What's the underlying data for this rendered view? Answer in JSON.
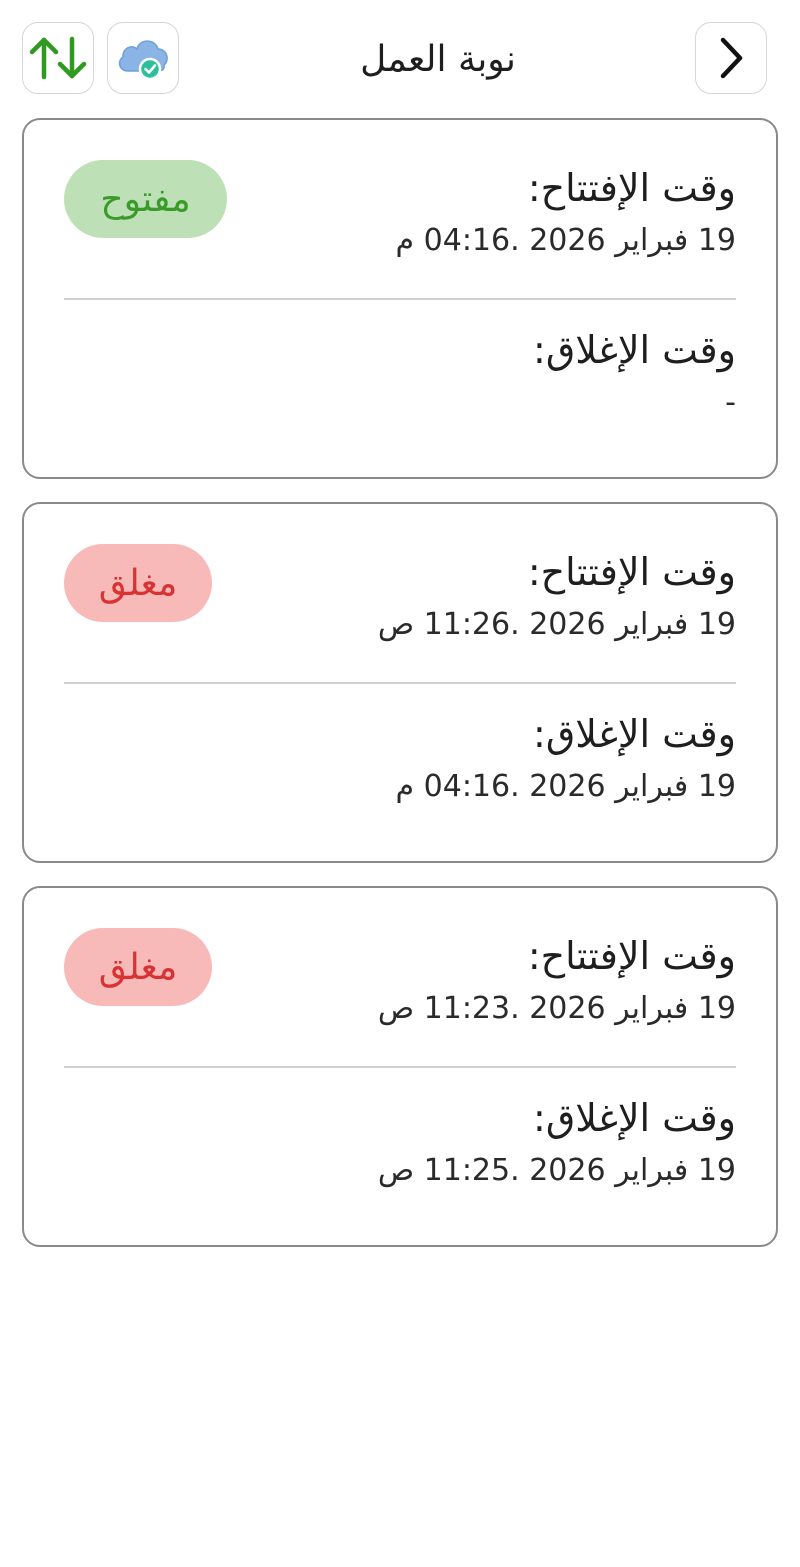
{
  "header": {
    "title": "نوبة العمل",
    "sort_icon": "sort-up-down-icon",
    "sync_icon": "cloud-synced-icon",
    "back_icon": "chevron-right-icon",
    "colors": {
      "sort_arrows": "#2e9a1f",
      "cloud": "#8ab4e6",
      "check_badge": "#2bbf9e"
    }
  },
  "shifts": [
    {
      "opening_label": "وقت الإفتتاح:",
      "opening_value": "19 فبراير 2026 .04:16 م",
      "closing_label": "وقت الإغلاق:",
      "closing_value": "-",
      "status": "مفتوح",
      "status_type": "open"
    },
    {
      "opening_label": "وقت الإفتتاح:",
      "opening_value": "19 فبراير 2026 .11:26 ص",
      "closing_label": "وقت الإغلاق:",
      "closing_value": "19 فبراير 2026 .04:16 م",
      "status": "مغلق",
      "status_type": "closed"
    },
    {
      "opening_label": "وقت الإفتتاح:",
      "opening_value": "19 فبراير 2026 .11:23 ص",
      "closing_label": "وقت الإغلاق:",
      "closing_value": "19 فبراير 2026 .11:25 ص",
      "status": "مغلق",
      "status_type": "closed"
    }
  ],
  "colors": {
    "open_badge_bg": "#bde0b6",
    "open_badge_text": "#3a9a2a",
    "closed_badge_bg": "#f8b9b9",
    "closed_badge_text": "#d83232",
    "card_border": "#8a8a8a"
  }
}
